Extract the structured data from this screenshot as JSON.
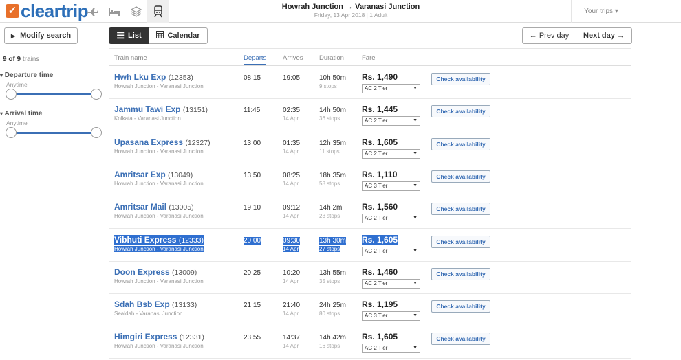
{
  "header": {
    "logo_text": "cleartrip",
    "route": "Howrah Junction → Varanasi Junction",
    "subtitle": "Friday, 13 Apr 2018 | 1 Adult",
    "your_trips": "Your trips ▾"
  },
  "toolbar": {
    "modify_search": "Modify search",
    "list": "List",
    "calendar": "Calendar",
    "prev_day": "← Prev day",
    "next_day": "Next day →"
  },
  "sidebar": {
    "count_bold": "9 of 9",
    "count_rest": " trains",
    "departure_title": "Departure time",
    "departure_sub": "Anytime",
    "arrival_title": "Arrival time",
    "arrival_sub": "Anytime"
  },
  "table": {
    "headers": [
      "Train name",
      "Departs",
      "Arrives",
      "Duration",
      "Fare"
    ],
    "check_label": "Check availability",
    "rows": [
      {
        "name": "Hwh Lku Exp",
        "num": "(12353)",
        "route": "Howrah Junction - Varanasi Junction",
        "dep": "08:15",
        "arr": "19:05",
        "arr_day": "",
        "dur": "10h 50m",
        "stops": "9 stops",
        "fare": "Rs. 1,490",
        "cls": "AC 2 Tier"
      },
      {
        "name": "Jammu Tawi Exp",
        "num": "(13151)",
        "route": "Kolkata - Varanasi Junction",
        "dep": "11:45",
        "arr": "02:35",
        "arr_day": "14 Apr",
        "dur": "14h 50m",
        "stops": "36 stops",
        "fare": "Rs. 1,445",
        "cls": "AC 2 Tier"
      },
      {
        "name": "Upasana Express",
        "num": "(12327)",
        "route": "Howrah Junction - Varanasi Junction",
        "dep": "13:00",
        "arr": "01:35",
        "arr_day": "14 Apr",
        "dur": "12h 35m",
        "stops": "11 stops",
        "fare": "Rs. 1,605",
        "cls": "AC 2 Tier"
      },
      {
        "name": "Amritsar Exp",
        "num": "(13049)",
        "route": "Howrah Junction - Varanasi Junction",
        "dep": "13:50",
        "arr": "08:25",
        "arr_day": "14 Apr",
        "dur": "18h 35m",
        "stops": "58 stops",
        "fare": "Rs. 1,110",
        "cls": "AC 3 Tier"
      },
      {
        "name": "Amritsar Mail",
        "num": "(13005)",
        "route": "Howrah Junction - Varanasi Junction",
        "dep": "19:10",
        "arr": "09:12",
        "arr_day": "14 Apr",
        "dur": "14h 2m",
        "stops": "23 stops",
        "fare": "Rs. 1,560",
        "cls": "AC 2 Tier"
      },
      {
        "name": "Vibhuti Express",
        "num": "(12333)",
        "route": "Howrah Junction - Varanasi Junction",
        "dep": "20:00",
        "arr": "09:30",
        "arr_day": "14 Apr",
        "dur": "13h 30m",
        "stops": "27 stops",
        "fare": "Rs. 1,605",
        "cls": "AC 2 Tier"
      },
      {
        "name": "Doon Express",
        "num": "(13009)",
        "route": "Howrah Junction - Varanasi Junction",
        "dep": "20:25",
        "arr": "10:20",
        "arr_day": "14 Apr",
        "dur": "13h 55m",
        "stops": "35 stops",
        "fare": "Rs. 1,460",
        "cls": "AC 2 Tier"
      },
      {
        "name": "Sdah Bsb Exp",
        "num": "(13133)",
        "route": "Sealdah - Varanasi Junction",
        "dep": "21:15",
        "arr": "21:40",
        "arr_day": "14 Apr",
        "dur": "24h 25m",
        "stops": "80 stops",
        "fare": "Rs. 1,195",
        "cls": "AC 3 Tier"
      },
      {
        "name": "Himgiri Express",
        "num": "(12331)",
        "route": "Howrah Junction - Varanasi Junction",
        "dep": "23:55",
        "arr": "14:37",
        "arr_day": "14 Apr",
        "dur": "14h 42m",
        "stops": "16 stops",
        "fare": "Rs. 1,605",
        "cls": "AC 2 Tier"
      }
    ]
  }
}
